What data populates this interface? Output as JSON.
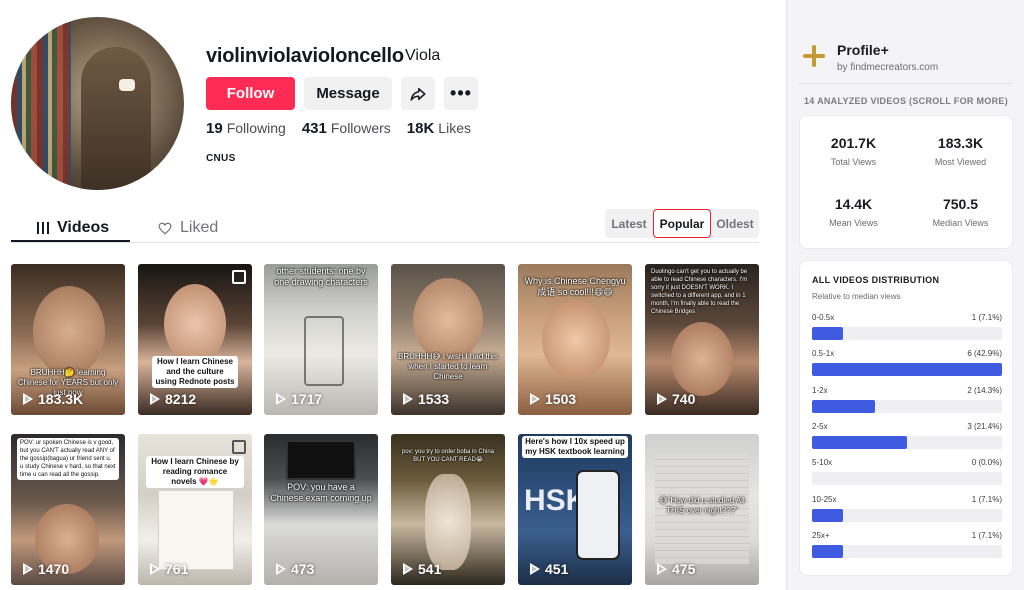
{
  "profile": {
    "username": "violinviolavioloncello",
    "nickname": "Viola",
    "follow_label": "Follow",
    "message_label": "Message",
    "following_count": "19",
    "following_label": "Following",
    "followers_count": "431",
    "followers_label": "Followers",
    "likes_count": "18K",
    "likes_label": "Likes",
    "bio": "CNUS"
  },
  "tabs": {
    "videos": "Videos",
    "liked": "Liked"
  },
  "sort": {
    "options": [
      "Latest",
      "Popular",
      "Oldest"
    ],
    "selected": "Popular"
  },
  "videos": [
    {
      "views": "183.3K",
      "caption": "BRUHHH🤔 learning Chinese for YEARS but only just now"
    },
    {
      "views": "8212",
      "caption": "How I learn Chinese and the culture using Rednote posts"
    },
    {
      "views": "1717",
      "caption": "other students: one by one drawing characters"
    },
    {
      "views": "1533",
      "caption": "BRUHHH😅 I wish I had this when I started to learn Chinese"
    },
    {
      "views": "1503",
      "caption": "Why is Chinese Chengyu成语 so cool!!!😄😄"
    },
    {
      "views": "740",
      "caption": "Duolingo can't get you to actually be able to read Chinese characters. I'm sorry it just DOESN'T WORK. I switched to a different app, and in 1 month, I'm finally able to read the Chinese Bridges"
    },
    {
      "views": "1470",
      "caption": "POV: ur spoken Chinese is v good, but you CAN'T actually read ANY of the gossip(bagua) ur friend sent u. u study Chinese v hard, so that next time u can read all the gossip."
    },
    {
      "views": "761",
      "caption": "How I learn Chinese by reading romance novels 💗🌟"
    },
    {
      "views": "473",
      "caption": "POV: you have a Chinese exam coming up"
    },
    {
      "views": "541",
      "caption": "pov: you try to order boba in China BUT YOU CANT READ😭"
    },
    {
      "views": "451",
      "caption": "Here's how I 10x speed up my HSK textbook learning"
    },
    {
      "views": "475",
      "caption": "😅\"How did u studied All THIS over night???\""
    }
  ],
  "panel": {
    "brand_title": "Profile+",
    "brand_sub": "by findmecreators.com",
    "analyzed_label": "14 ANALYZED VIDEOS (SCROLL FOR MORE)",
    "stats": [
      {
        "value": "201.7K",
        "label": "Total Views"
      },
      {
        "value": "183.3K",
        "label": "Most Viewed"
      },
      {
        "value": "14.4K",
        "label": "Mean Views"
      },
      {
        "value": "750.5",
        "label": "Median Views"
      }
    ],
    "dist_title": "ALL VIDEOS DISTRIBUTION",
    "dist_sub": "Relative to median views",
    "distribution": [
      {
        "range": "0-0.5x",
        "value": "1 (7.1%)",
        "pct": 7.1
      },
      {
        "range": "0.5-1x",
        "value": "6 (42.9%)",
        "pct": 42.9
      },
      {
        "range": "1-2x",
        "value": "2 (14.3%)",
        "pct": 14.3
      },
      {
        "range": "2-5x",
        "value": "3 (21.4%)",
        "pct": 21.4
      },
      {
        "range": "5-10x",
        "value": "0 (0.0%)",
        "pct": 0
      },
      {
        "range": "10-25x",
        "value": "1 (7.1%)",
        "pct": 7.1
      },
      {
        "range": "25x+",
        "value": "1 (7.1%)",
        "pct": 7.1
      }
    ],
    "accent_color": "#3f5be0"
  },
  "colors": {
    "follow": "#fe2c55",
    "sort_highlight": "#e0242e"
  }
}
